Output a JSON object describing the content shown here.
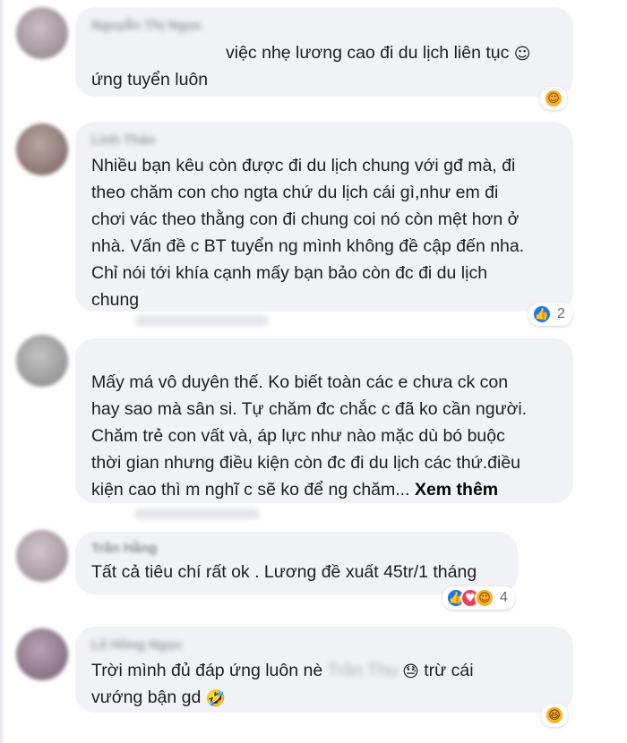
{
  "comments": [
    {
      "author": "Nguyễn Thị Ngọc",
      "text": "việc nhẹ lương cao đi du lịch liên tục",
      "text_line2": "ứng tuyển luôn",
      "inline_emoji": "☺",
      "reactions": {
        "icons": [
          "care"
        ],
        "count": ""
      }
    },
    {
      "author": "Linh Thảo",
      "lines": [
        "Nhiều bạn kêu còn được đi du lịch chung với gđ mà, đi",
        "theo chăm con cho ngta chứ du lịch cái gì,như em đi",
        "chơi vác theo thằng con đi chung coi nó còn mệt hơn ở",
        "nhà. Vấn đề c BT tuyển ng mình không đề cập đến nha.",
        "Chỉ nói tới khía cạnh mấy bạn bảo còn đc đi du lịch",
        "chung"
      ],
      "reactions": {
        "icons": [
          "like"
        ],
        "count": "2"
      }
    },
    {
      "author": "",
      "lines": [
        "Mấy má vô duyên thế. Ko biết toàn các e chưa ck con",
        "hay sao mà sân si. Tự chăm đc chắc c đã ko cần người.",
        "Chăm trẻ con vất và, áp lực như nào mặc dù bó buộc",
        "thời gian nhưng điều kiện còn đc đi du lịch các thứ.điều"
      ],
      "last_line": "kiện cao thì m nghĩ c sẽ ko để ng chăm...",
      "see_more": "Xem thêm"
    },
    {
      "author": "Trần Hằng",
      "text": "Tất cả tiêu chí rất ok . Lương đề xuất 45tr/1 tháng",
      "reactions": {
        "icons": [
          "like",
          "love",
          "care"
        ],
        "count": "4"
      }
    },
    {
      "author": "Lê Hồng Ngọc",
      "text_before": "Trời mình đủ đáp ứng luôn nè",
      "mention": "Trần Thu",
      "text_after": "trừ cái",
      "inline_emoji_1": "😓",
      "line2": "vướng bận gd",
      "inline_emoji_2": "🤣",
      "reactions": {
        "icons": [
          "haha"
        ],
        "count": ""
      }
    }
  ],
  "icons": {
    "like": "👍",
    "love": "♥",
    "care": "☺",
    "haha": "😆"
  },
  "colors": {
    "bubble": "#f0f2f5",
    "like": "#1877f2",
    "love": "#f33e58",
    "care": "#f7b125",
    "text": "#1c1e21"
  }
}
